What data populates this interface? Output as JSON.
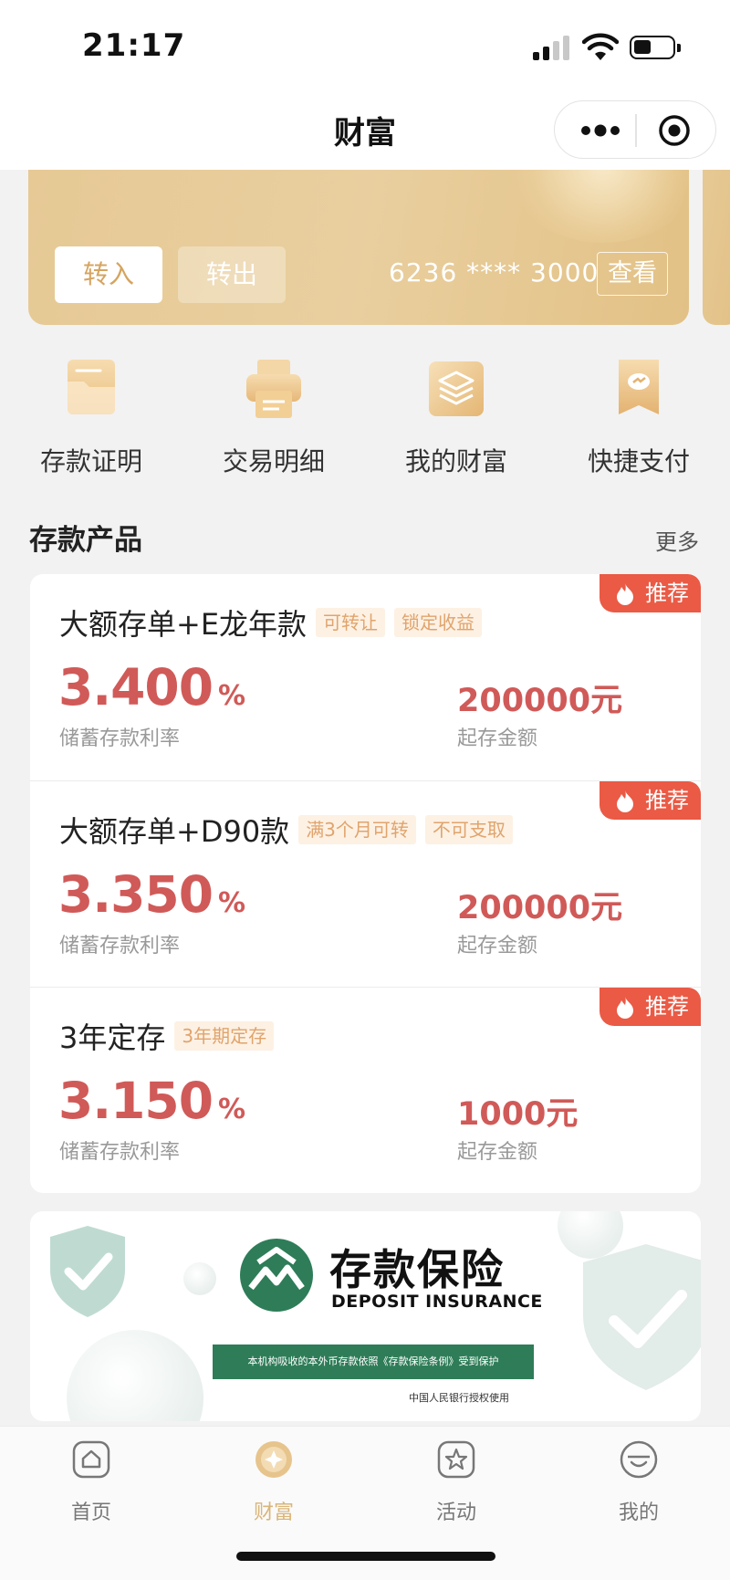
{
  "status_bar": {
    "time": "21:17"
  },
  "nav": {
    "title": "财富",
    "more_icon": "more-dots-icon",
    "close_icon": "target-icon"
  },
  "account_card": {
    "transfer_in_label": "转入",
    "transfer_out_label": "转出",
    "card_number": "6236 **** 3000",
    "view_label": "查看",
    "accent_color": "#e6c995"
  },
  "quick_entries": [
    {
      "label": "存款证明",
      "icon": "folder-icon"
    },
    {
      "label": "交易明细",
      "icon": "printer-icon"
    },
    {
      "label": "我的财富",
      "icon": "layers-icon"
    },
    {
      "label": "快捷支付",
      "icon": "payment-icon"
    }
  ],
  "products_section": {
    "title": "存款产品",
    "more_label": "更多",
    "products": [
      {
        "name": "大额存单+E龙年款",
        "tags": [
          "可转让",
          "锁定收益"
        ],
        "rate": "3.400",
        "rate_unit": "%",
        "rate_label": "储蓄存款利率",
        "amount": "200000元",
        "amount_label": "起存金额",
        "badge": "推荐"
      },
      {
        "name": "大额存单+D90款",
        "tags": [
          "满3个月可转",
          "不可支取"
        ],
        "rate": "3.350",
        "rate_unit": "%",
        "rate_label": "储蓄存款利率",
        "amount": "200000元",
        "amount_label": "起存金额",
        "badge": "推荐"
      },
      {
        "name": "3年定存",
        "tags": [
          "3年期定存"
        ],
        "rate": "3.150",
        "rate_unit": "%",
        "rate_label": "储蓄存款利率",
        "amount": "1000元",
        "amount_label": "起存金额",
        "badge": "推荐"
      }
    ],
    "rate_color": "#d05a58",
    "badge_color": "#ea5a45"
  },
  "insurance_banner": {
    "title": "存款保险",
    "subtitle": "DEPOSIT INSURANCE",
    "strip_text": "本机构吸收的本外币存款依照《存款保险条例》受到保护",
    "note": "中国人民银行授权使用",
    "brand_color": "#2e7d58"
  },
  "tab_bar": {
    "items": [
      {
        "label": "首页",
        "icon": "home-icon",
        "active": false
      },
      {
        "label": "财富",
        "icon": "wealth-icon",
        "active": true
      },
      {
        "label": "活动",
        "icon": "star-icon",
        "active": false
      },
      {
        "label": "我的",
        "icon": "profile-icon",
        "active": false
      }
    ],
    "active_color": "#d9b57a"
  }
}
